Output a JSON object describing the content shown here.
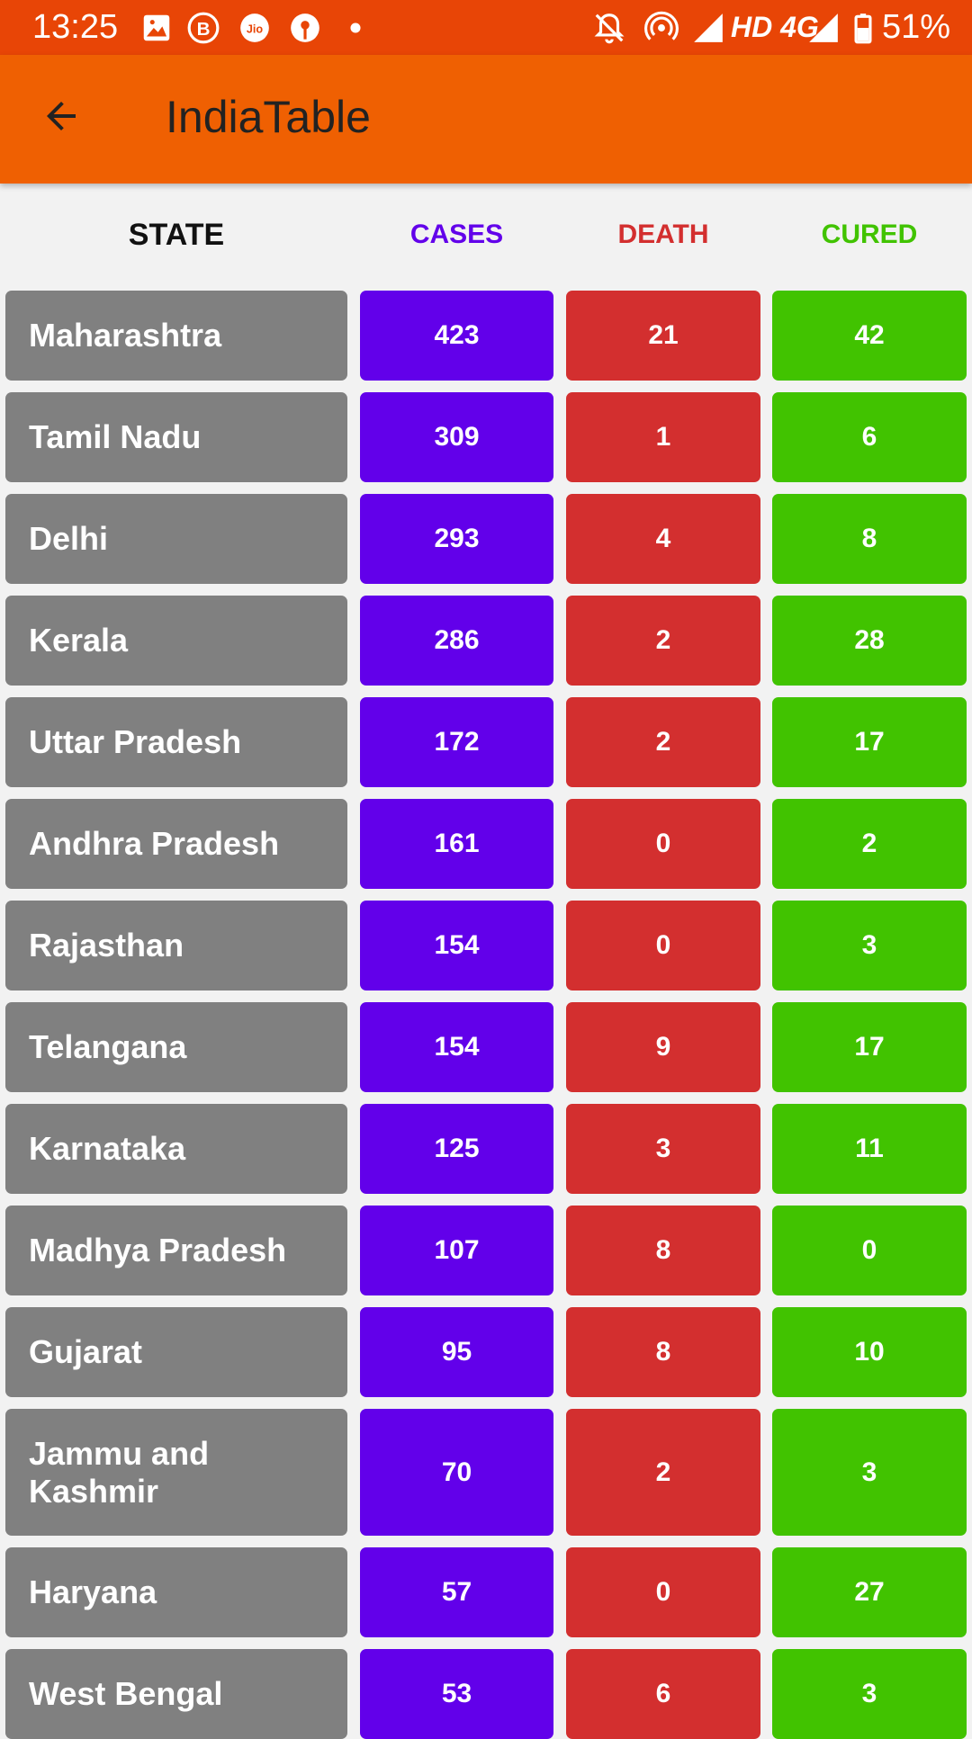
{
  "status_bar": {
    "time": "13:25",
    "network": "HD 4G",
    "battery": "51%",
    "icons": [
      "image-icon",
      "b-icon",
      "jio-icon",
      "bank-icon",
      "dot-icon",
      "mute-icon",
      "hotspot-icon",
      "signal-icon",
      "battery-icon"
    ]
  },
  "app_bar": {
    "title": "IndiaTable",
    "back_icon": "back-arrow-icon"
  },
  "colors": {
    "status_bar": "#e84506",
    "app_bar": "#ef6002",
    "state_bg": "#808080",
    "cases": "#6200ea",
    "death": "#d32f2f",
    "cured": "#41c300"
  },
  "table": {
    "headers": {
      "state": "STATE",
      "cases": "CASES",
      "death": "DEATH",
      "cured": "CURED"
    },
    "rows": [
      {
        "state": "Maharashtra",
        "cases": "423",
        "death": "21",
        "cured": "42"
      },
      {
        "state": "Tamil Nadu",
        "cases": "309",
        "death": "1",
        "cured": "6"
      },
      {
        "state": "Delhi",
        "cases": "293",
        "death": "4",
        "cured": "8"
      },
      {
        "state": "Kerala",
        "cases": "286",
        "death": "2",
        "cured": "28"
      },
      {
        "state": "Uttar Pradesh",
        "cases": "172",
        "death": "2",
        "cured": "17"
      },
      {
        "state": "Andhra Pradesh",
        "cases": "161",
        "death": "0",
        "cured": "2"
      },
      {
        "state": "Rajasthan",
        "cases": "154",
        "death": "0",
        "cured": "3"
      },
      {
        "state": "Telangana",
        "cases": "154",
        "death": "9",
        "cured": "17"
      },
      {
        "state": "Karnataka",
        "cases": "125",
        "death": "3",
        "cured": "11"
      },
      {
        "state": "Madhya Pradesh",
        "cases": "107",
        "death": "8",
        "cured": "0"
      },
      {
        "state": "Gujarat",
        "cases": "95",
        "death": "8",
        "cured": "10"
      },
      {
        "state": "Jammu and Kashmir",
        "cases": "70",
        "death": "2",
        "cured": "3"
      },
      {
        "state": "Haryana",
        "cases": "57",
        "death": "0",
        "cured": "27"
      },
      {
        "state": "West Bengal",
        "cases": "53",
        "death": "6",
        "cured": "3"
      }
    ]
  }
}
